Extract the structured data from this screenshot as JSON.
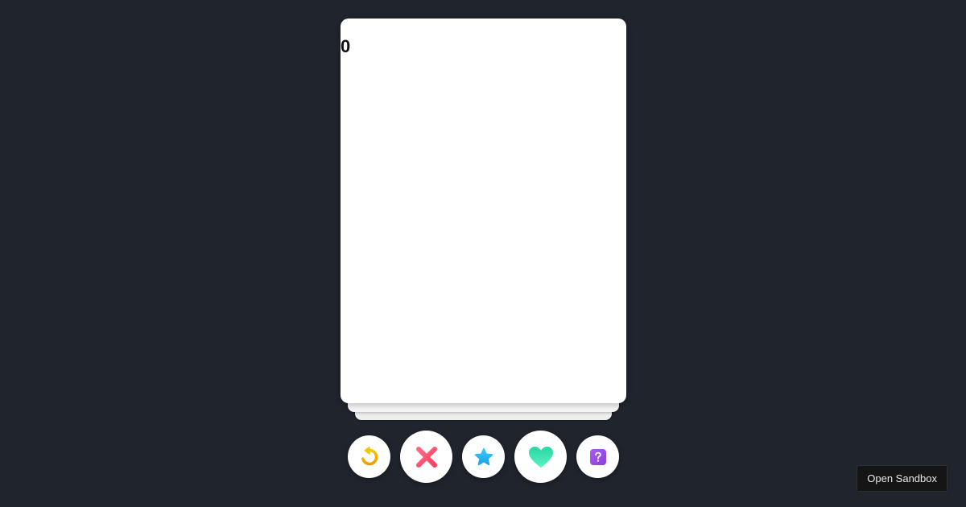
{
  "card": {
    "counter": "0"
  },
  "actions": [
    {
      "name": "rewind-button",
      "icon": "rewind-icon",
      "color": "#f5b300"
    },
    {
      "name": "nope-button",
      "icon": "close-icon",
      "color": "#fd4b6a"
    },
    {
      "name": "super-like-button",
      "icon": "star-icon",
      "color": "#25b6f5"
    },
    {
      "name": "like-button",
      "icon": "heart-icon",
      "color": "#2fd1a0"
    },
    {
      "name": "help-button",
      "icon": "question-icon",
      "color": "#9b4fe0"
    }
  ],
  "footer": {
    "open_sandbox_label": "Open Sandbox"
  }
}
